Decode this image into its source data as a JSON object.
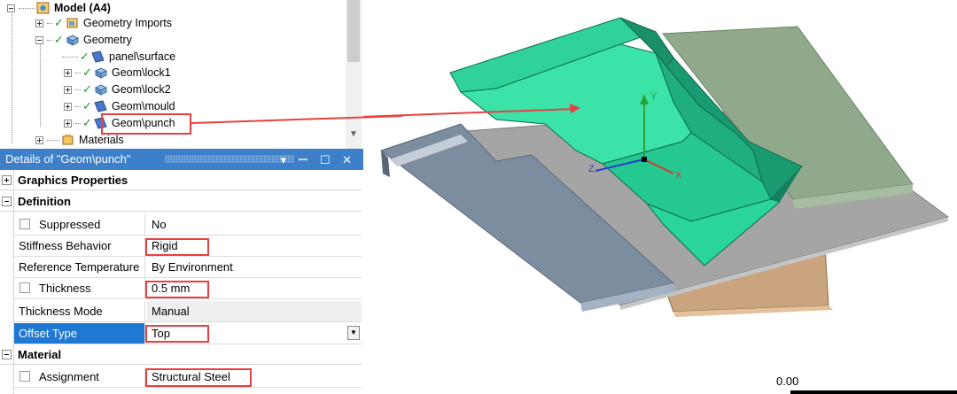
{
  "tree": {
    "items": [
      {
        "label": "Model (A4)",
        "icon": "model-icon"
      },
      {
        "label": "Geometry Imports",
        "icon": "geometry-imports-icon"
      },
      {
        "label": "Geometry",
        "icon": "geometry-icon"
      },
      {
        "label": "panel\\surface",
        "icon": "surface-body-icon"
      },
      {
        "label": "Geom\\lock1",
        "icon": "solid-body-icon"
      },
      {
        "label": "Geom\\lock2",
        "icon": "solid-body-icon"
      },
      {
        "label": "Geom\\mould",
        "icon": "surface-body-icon"
      },
      {
        "label": "Geom\\punch",
        "icon": "surface-body-icon"
      },
      {
        "label": "Materials",
        "icon": "materials-icon"
      }
    ]
  },
  "details": {
    "title": "Details of \"Geom\\punch\"",
    "title_buttons": "▾ ꟷ ☐ ✕",
    "sections": {
      "graphics": "Graphics Properties",
      "definition": "Definition",
      "material": "Material"
    },
    "rows": {
      "suppressed": {
        "label": "Suppressed",
        "value": "No"
      },
      "stiffness": {
        "label": "Stiffness Behavior",
        "value": "Rigid"
      },
      "ref_temp": {
        "label": "Reference Temperature",
        "value": "By Environment"
      },
      "thickness": {
        "label": "Thickness",
        "value": "0.5 mm"
      },
      "thickness_mode": {
        "label": "Thickness Mode",
        "value": "Manual"
      },
      "offset_type": {
        "label": "Offset Type",
        "value": "Top"
      },
      "assignment": {
        "label": "Assignment",
        "value": "Structural Steel"
      }
    }
  },
  "viewport": {
    "axes": {
      "x": "X",
      "y": "Y",
      "z": "Z"
    },
    "scale_label": "0.00"
  },
  "colors": {
    "highlight": "#e84040",
    "punch_green": "#2fd39a",
    "blank_gray": "#8c9cae",
    "lock_green": "#8fa98a",
    "mould_copper": "#c9a47e",
    "selection_blue": "#1f78d1"
  }
}
